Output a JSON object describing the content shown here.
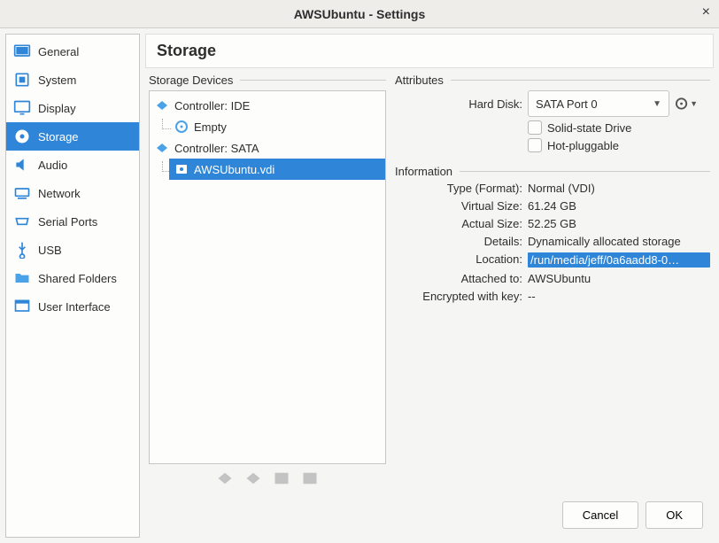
{
  "window": {
    "title": "AWSUbuntu - Settings"
  },
  "sidebar": {
    "items": [
      {
        "label": "General"
      },
      {
        "label": "System"
      },
      {
        "label": "Display"
      },
      {
        "label": "Storage"
      },
      {
        "label": "Audio"
      },
      {
        "label": "Network"
      },
      {
        "label": "Serial Ports"
      },
      {
        "label": "USB"
      },
      {
        "label": "Shared Folders"
      },
      {
        "label": "User Interface"
      }
    ],
    "selected": "Storage"
  },
  "page": {
    "title": "Storage",
    "devices_label": "Storage Devices",
    "attributes_label": "Attributes"
  },
  "tree": {
    "controllers": [
      {
        "label": "Controller: IDE",
        "children": [
          {
            "label": "Empty",
            "selected": false
          }
        ]
      },
      {
        "label": "Controller: SATA",
        "children": [
          {
            "label": "AWSUbuntu.vdi",
            "selected": true
          }
        ]
      }
    ]
  },
  "attributes": {
    "hard_disk_label": "Hard Disk:",
    "hard_disk_value": "SATA Port 0",
    "ssd_label": "Solid-state Drive",
    "hotplug_label": "Hot-pluggable"
  },
  "info": {
    "header": "Information",
    "rows": [
      {
        "key": "Type (Format):",
        "val": "Normal (VDI)"
      },
      {
        "key": "Virtual Size:",
        "val": "61.24 GB"
      },
      {
        "key": "Actual Size:",
        "val": "52.25 GB"
      },
      {
        "key": "Details:",
        "val": "Dynamically allocated storage"
      },
      {
        "key": "Location:",
        "val": "/run/media/jeff/0a6aadd8-0…",
        "highlight": true
      },
      {
        "key": "Attached to:",
        "val": "AWSUbuntu"
      },
      {
        "key": "Encrypted with key:",
        "val": "--"
      }
    ]
  },
  "footer": {
    "cancel": "Cancel",
    "ok": "OK"
  }
}
